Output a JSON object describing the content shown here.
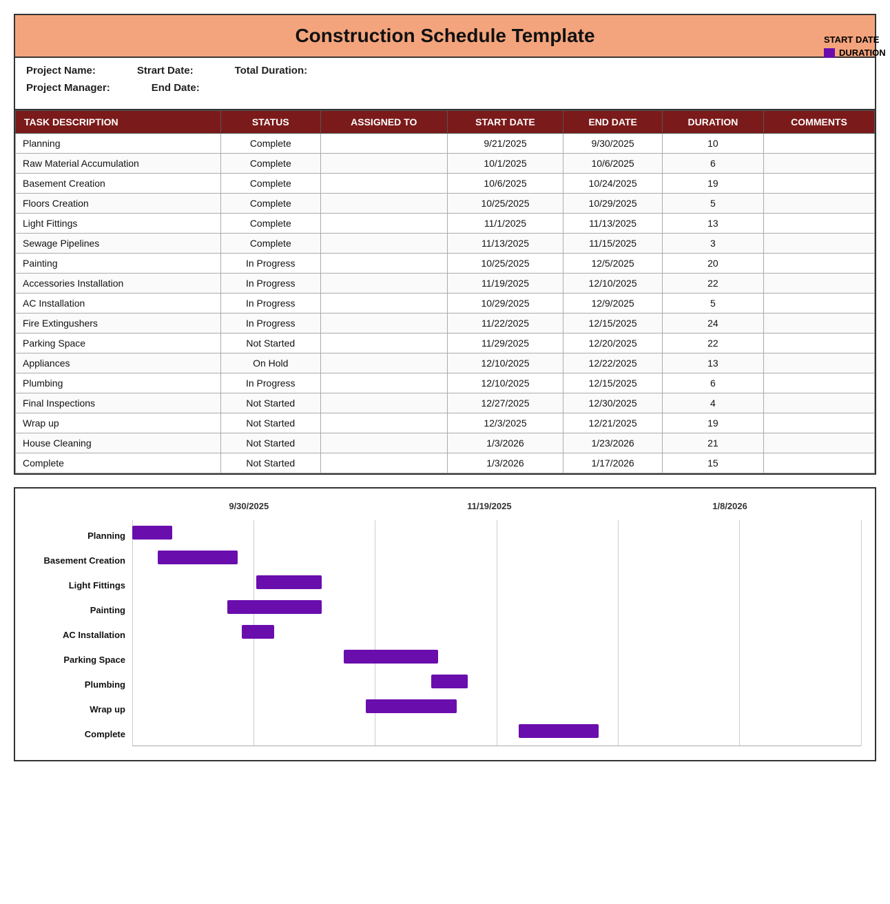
{
  "title": "Construction Schedule Template",
  "meta": {
    "project_name_label": "Project Name:",
    "start_date_label": "Strart Date:",
    "total_duration_label": "Total Duration:",
    "project_manager_label": "Project Manager:",
    "end_date_label": "End Date:"
  },
  "table": {
    "headers": [
      "TASK DESCRIPTION",
      "STATUS",
      "ASSIGNED TO",
      "START DATE",
      "END DATE",
      "DURATION",
      "COMMENTS"
    ],
    "rows": [
      {
        "task": "Planning",
        "status": "Complete",
        "assigned": "",
        "start": "9/21/2025",
        "end": "9/30/2025",
        "duration": "10",
        "comments": ""
      },
      {
        "task": "Raw Material Accumulation",
        "status": "Complete",
        "assigned": "",
        "start": "10/1/2025",
        "end": "10/6/2025",
        "duration": "6",
        "comments": ""
      },
      {
        "task": "Basement Creation",
        "status": "Complete",
        "assigned": "",
        "start": "10/6/2025",
        "end": "10/24/2025",
        "duration": "19",
        "comments": ""
      },
      {
        "task": "Floors Creation",
        "status": "Complete",
        "assigned": "",
        "start": "10/25/2025",
        "end": "10/29/2025",
        "duration": "5",
        "comments": ""
      },
      {
        "task": "Light Fittings",
        "status": "Complete",
        "assigned": "",
        "start": "11/1/2025",
        "end": "11/13/2025",
        "duration": "13",
        "comments": ""
      },
      {
        "task": "Sewage Pipelines",
        "status": "Complete",
        "assigned": "",
        "start": "11/13/2025",
        "end": "11/15/2025",
        "duration": "3",
        "comments": ""
      },
      {
        "task": "Painting",
        "status": "In Progress",
        "assigned": "",
        "start": "10/25/2025",
        "end": "12/5/2025",
        "duration": "20",
        "comments": ""
      },
      {
        "task": "Accessories Installation",
        "status": "In Progress",
        "assigned": "",
        "start": "11/19/2025",
        "end": "12/10/2025",
        "duration": "22",
        "comments": ""
      },
      {
        "task": "AC Installation",
        "status": "In Progress",
        "assigned": "",
        "start": "10/29/2025",
        "end": "12/9/2025",
        "duration": "5",
        "comments": ""
      },
      {
        "task": "Fire Extingushers",
        "status": "In Progress",
        "assigned": "",
        "start": "11/22/2025",
        "end": "12/15/2025",
        "duration": "24",
        "comments": ""
      },
      {
        "task": "Parking Space",
        "status": "Not Started",
        "assigned": "",
        "start": "11/29/2025",
        "end": "12/20/2025",
        "duration": "22",
        "comments": ""
      },
      {
        "task": "Appliances",
        "status": "On Hold",
        "assigned": "",
        "start": "12/10/2025",
        "end": "12/22/2025",
        "duration": "13",
        "comments": ""
      },
      {
        "task": "Plumbing",
        "status": "In Progress",
        "assigned": "",
        "start": "12/10/2025",
        "end": "12/15/2025",
        "duration": "6",
        "comments": ""
      },
      {
        "task": "Final Inspections",
        "status": "Not Started",
        "assigned": "",
        "start": "12/27/2025",
        "end": "12/30/2025",
        "duration": "4",
        "comments": ""
      },
      {
        "task": "Wrap up",
        "status": "Not Started",
        "assigned": "",
        "start": "12/3/2025",
        "end": "12/21/2025",
        "duration": "19",
        "comments": ""
      },
      {
        "task": "House Cleaning",
        "status": "Not Started",
        "assigned": "",
        "start": "1/3/2026",
        "end": "1/23/2026",
        "duration": "21",
        "comments": ""
      },
      {
        "task": "Complete",
        "status": "Not Started",
        "assigned": "",
        "start": "1/3/2026",
        "end": "1/17/2026",
        "duration": "15",
        "comments": ""
      }
    ]
  },
  "chart": {
    "axis_labels": [
      "9/30/2025",
      "11/19/2025",
      "1/8/2026"
    ],
    "legend": {
      "title": "START DATE",
      "color_label": "DURATION"
    },
    "rows": [
      {
        "label": "Planning",
        "start_pct": 0,
        "width_pct": 5.5
      },
      {
        "label": "Basement Creation",
        "start_pct": 3.5,
        "width_pct": 11
      },
      {
        "label": "Light Fittings",
        "start_pct": 17,
        "width_pct": 9
      },
      {
        "label": "Painting",
        "start_pct": 13,
        "width_pct": 13
      },
      {
        "label": "AC Installation",
        "start_pct": 15,
        "width_pct": 4.5
      },
      {
        "label": "Parking Space",
        "start_pct": 29,
        "width_pct": 13
      },
      {
        "label": "Plumbing",
        "start_pct": 41,
        "width_pct": 5
      },
      {
        "label": "Wrap up",
        "start_pct": 32,
        "width_pct": 12.5
      },
      {
        "label": "Complete",
        "start_pct": 53,
        "width_pct": 11
      }
    ]
  }
}
